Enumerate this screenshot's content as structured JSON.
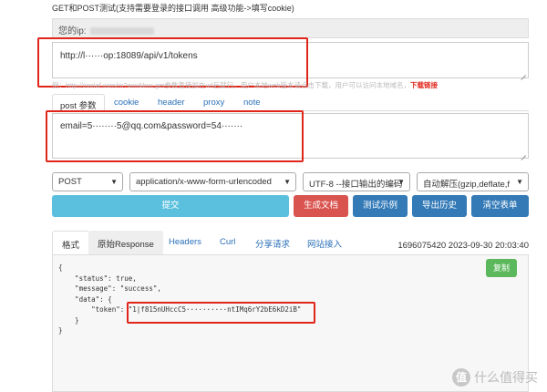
{
  "page": {
    "title": "GET和POST测试(支持需要登录的接口调用 高级功能->填写cookie)"
  },
  "ip": {
    "label": "您的ip:"
  },
  "request": {
    "url": "http://l······op:18089/api/v1/tokens",
    "hint": "例：http://coolaf.com/m?axx&bxx,get参数直接加在url后就行。用户本地web版本请点击下载，用户可以访问本地域名，",
    "hint_link": "下载链接",
    "body": "email=5········5@qq.com&password=54·······"
  },
  "request_tabs": [
    {
      "label": "post 参数",
      "active": true
    },
    {
      "label": "cookie",
      "active": false
    },
    {
      "label": "header",
      "active": false
    },
    {
      "label": "proxy",
      "active": false
    },
    {
      "label": "note",
      "active": false
    }
  ],
  "selects": {
    "method": "POST",
    "content_type": "application/x-www-form-urlencoded",
    "charset": "UTF-8 --接口输出的编码",
    "decompress": "自动解压(gzip,deflate,f"
  },
  "buttons": {
    "submit": "提交",
    "generate_doc": "生成文档",
    "test_example": "测试示例",
    "export_history": "导出历史",
    "clear_form": "清空表单",
    "copy": "复制"
  },
  "response_tabs": [
    {
      "label": "格式",
      "state": "active"
    },
    {
      "label": "原始Response",
      "state": "alt"
    },
    {
      "label": "Headers",
      "state": "normal"
    },
    {
      "label": "Curl",
      "state": "normal"
    },
    {
      "label": "分享请求",
      "state": "normal"
    },
    {
      "label": "网站接入",
      "state": "normal"
    }
  ],
  "response": {
    "timestamp": "1696075420 2023-09-30 20:03:40",
    "lines": [
      "{",
      "    \"status\": true,",
      "    \"message\": \"success\",",
      "    \"data\": {",
      "        \"token\": \"1|f815nUHccC5··········ntIMq6rY2bE6kD2iB\"",
      "    }",
      "}"
    ]
  },
  "watermark": {
    "icon_text": "值",
    "text": "什么值得买"
  },
  "colors": {
    "annotation_red": "#e0261a",
    "submit_button": "#5bc0de",
    "generate_button": "#d9534f",
    "primary_button": "#337ab7",
    "copy_button": "#5cb85c",
    "link_blue": "#2a6fb8"
  }
}
